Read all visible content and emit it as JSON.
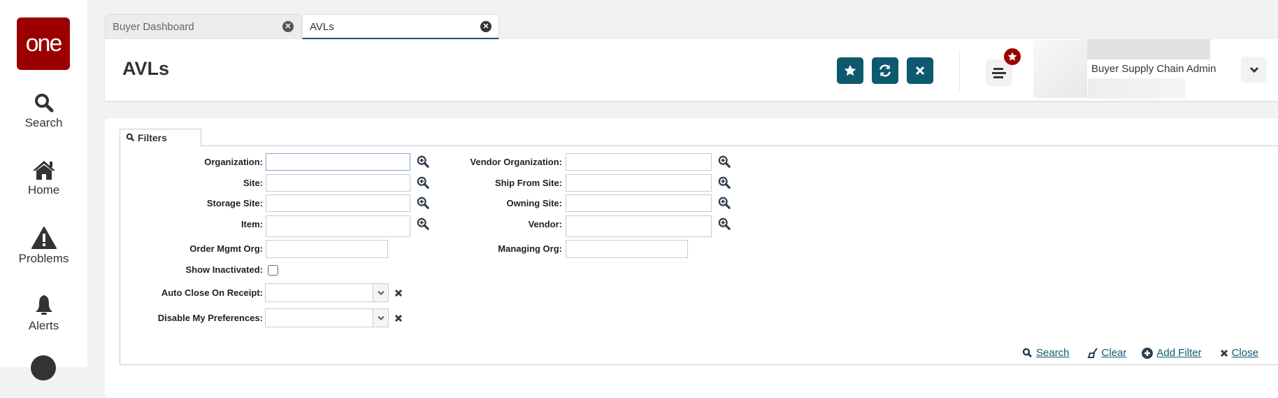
{
  "logo": "one",
  "sidebar": {
    "items": [
      {
        "label": "Search",
        "icon": "search-icon"
      },
      {
        "label": "Home",
        "icon": "home-icon"
      },
      {
        "label": "Problems",
        "icon": "warning-icon"
      },
      {
        "label": "Alerts",
        "icon": "bell-icon"
      }
    ]
  },
  "tabs": [
    {
      "label": "Buyer Dashboard"
    },
    {
      "label": "AVLs"
    }
  ],
  "header": {
    "title": "AVLs",
    "user_role": "Buyer Supply Chain Admin"
  },
  "filters": {
    "tab_label": "Filters",
    "left": [
      {
        "label": "Organization:",
        "value": ""
      },
      {
        "label": "Site:",
        "value": ""
      },
      {
        "label": "Storage Site:",
        "value": ""
      },
      {
        "label": "Item:",
        "value": ""
      },
      {
        "label": "Order Mgmt Org:",
        "value": ""
      }
    ],
    "show_inactivated": {
      "label": "Show Inactivated:",
      "checked": false
    },
    "selects": [
      {
        "label": "Auto Close On Receipt:",
        "value": ""
      },
      {
        "label": "Disable My Preferences:",
        "value": ""
      }
    ],
    "right": [
      {
        "label": "Vendor Organization:",
        "value": ""
      },
      {
        "label": "Ship From Site:",
        "value": ""
      },
      {
        "label": "Owning Site:",
        "value": ""
      },
      {
        "label": "Vendor:",
        "value": ""
      },
      {
        "label": "Managing Org:",
        "value": ""
      }
    ],
    "actions": {
      "search": "Search",
      "clear": "Clear",
      "add_filter": "Add Filter",
      "close": "Close"
    }
  },
  "colors": {
    "brand": "#9b0000",
    "accent": "#0d5a6e"
  }
}
